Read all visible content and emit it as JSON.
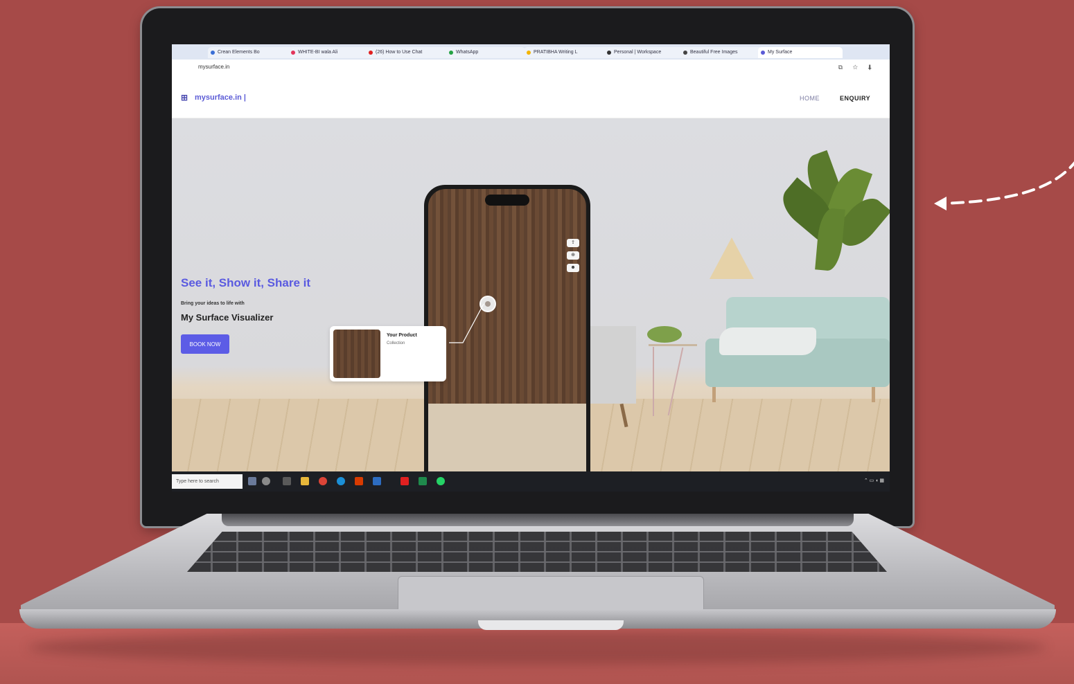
{
  "browser": {
    "tabs": [
      {
        "label": "Crean Elements Bo",
        "color": "#3b6fd6"
      },
      {
        "label": "WHITE-BI wala Ali",
        "color": "#e2345a"
      },
      {
        "label": "(26) How to Use Chat",
        "color": "#e02020"
      },
      {
        "label": "WhatsApp",
        "color": "#25a244"
      },
      {
        "label": "PRATIBHA Writing L",
        "color": "#f4b400"
      },
      {
        "label": "Personal | Workspace",
        "color": "#333333"
      },
      {
        "label": "Beautiful Free Images",
        "color": "#444444"
      },
      {
        "label": "My Surface",
        "color": "#5b5bd6"
      }
    ],
    "url": "mysurface.in"
  },
  "site": {
    "logo_text": "mysurface.in |",
    "nav": {
      "home": "HOME",
      "enquiry": "ENQUIRY"
    }
  },
  "hero": {
    "headline": "See it, Show it, Share it",
    "subline": "Bring your ideas to life with",
    "product_name": "My Surface Visualizer",
    "cta_label": "BOOK NOW"
  },
  "card": {
    "title": "Your Product",
    "subtitle": "Collection"
  },
  "taskbar": {
    "search_placeholder": "Type here to search"
  },
  "colors": {
    "background": "#a64a48",
    "accent": "#5b5bd6"
  }
}
